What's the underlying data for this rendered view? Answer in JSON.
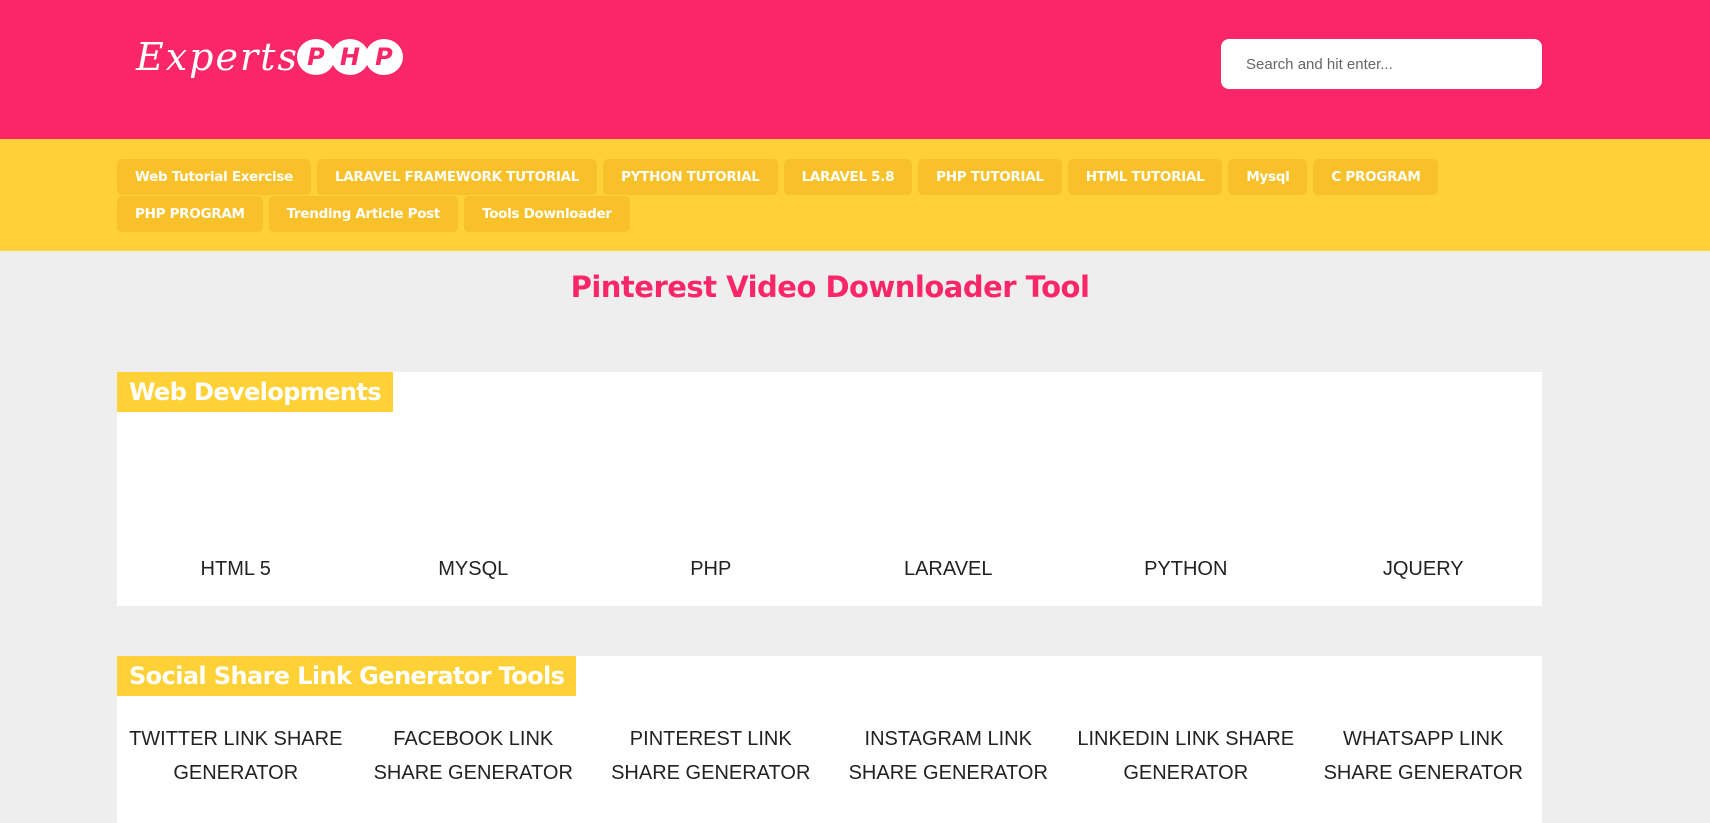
{
  "header": {
    "logo_text": "Experts",
    "logo_badge": [
      "P",
      "H",
      "P"
    ],
    "search_placeholder": "Search and hit enter..."
  },
  "nav": {
    "items": [
      "Web Tutorial Exercise",
      "LARAVEL FRAMEWORK TUTORIAL",
      "PYTHON TUTORIAL",
      "LARAVEL 5.8",
      "PHP TUTORIAL",
      "HTML TUTORIAL",
      "Mysql",
      "C PROGRAM",
      "PHP PROGRAM",
      "Trending Article Post",
      "Tools Downloader"
    ]
  },
  "main": {
    "title": "Pinterest Video Downloader Tool"
  },
  "web_developments": {
    "heading": "Web Developments",
    "items": [
      "HTML 5",
      "MYSQL",
      "PHP",
      "LARAVEL",
      "PYTHON",
      "JQUERY"
    ]
  },
  "social_tools": {
    "heading": "Social Share Link Generator Tools",
    "items": [
      "TWITTER LINK SHARE GENERATOR",
      "FACEBOOK LINK SHARE GENERATOR",
      "PINTEREST LINK SHARE GENERATOR",
      "INSTAGRAM LINK SHARE GENERATOR",
      "LINKEDIN LINK SHARE GENERATOR",
      "WHATSAPP LINK SHARE GENERATOR"
    ]
  },
  "colors": {
    "header_bg": "#f9266a",
    "nav_bg": "#fed136",
    "nav_item_bg": "#f8c12a",
    "page_bg": "#eeeeee"
  }
}
